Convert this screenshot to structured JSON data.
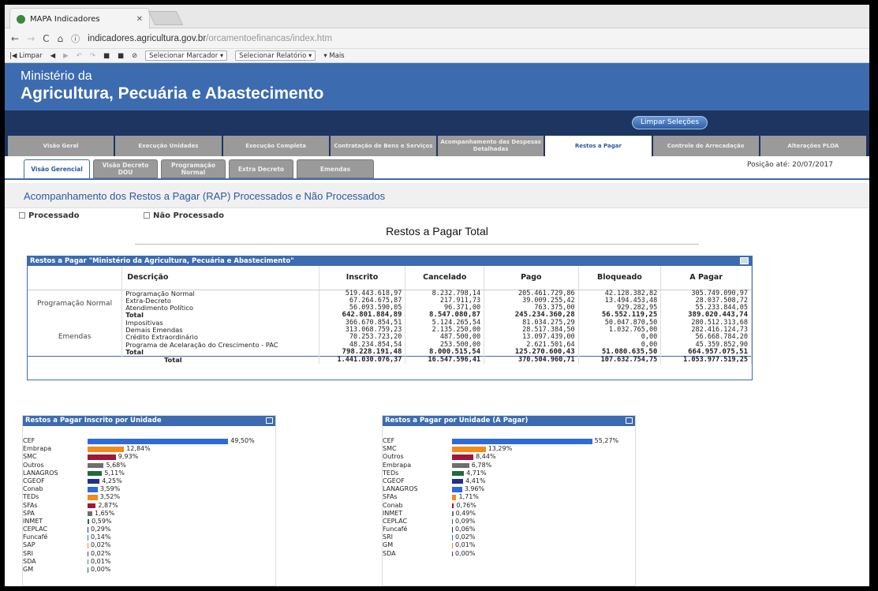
{
  "browser": {
    "tab_title": "MAPA Indicadores",
    "url_host": "indicadores.agricultura.gov.br",
    "url_path": "/orcamentoefinancas/index.htm",
    "bookmarks": {
      "clear": "Limpar",
      "marker": "Selecionar Marcador",
      "report": "Selecionar Relatório",
      "more": "Mais"
    }
  },
  "header": {
    "line1": "Ministério da",
    "line2": "Agricultura, Pecuária e Abastecimento",
    "clear_button": "Limpar Seleções"
  },
  "nav1": [
    {
      "label": "Visão Geral",
      "active": false
    },
    {
      "label": "Execução Unidades",
      "active": false
    },
    {
      "label": "Execução Completa",
      "active": false
    },
    {
      "label": "Contratação de Bens e Serviços",
      "active": false
    },
    {
      "label": "Acompanhamento das Despesas Detalhadas",
      "active": false
    },
    {
      "label": "Restos a Pagar",
      "active": true
    },
    {
      "label": "Controle de Arrecadação",
      "active": false
    },
    {
      "label": "Alterações PLOA",
      "active": false
    }
  ],
  "nav2": [
    {
      "label": "Visão Gerencial",
      "active": true
    },
    {
      "label": "Visão Decreto DOU",
      "active": false
    },
    {
      "label": "Programação Normal",
      "active": false
    },
    {
      "label": "Extra Decreto",
      "active": false
    },
    {
      "label": "Emendas",
      "active": false
    }
  ],
  "position_date": "Posição até: 20/07/2017",
  "section_title": "Acompanhamento dos Restos a Pagar (RAP) Processados e Não Processados",
  "filters": {
    "processed": "Processado",
    "not_processed": "Não Processado"
  },
  "report_title": "Restos a Pagar Total",
  "table": {
    "caption": "Restos a Pagar \"Ministério da Agricultura, Pecuária e Abastecimento\"",
    "columns": [
      "Descrição",
      "Inscrito",
      "Cancelado",
      "Pago",
      "Bloqueado",
      "A Pagar"
    ],
    "groups": [
      {
        "name": "Programação Normal",
        "rows": [
          [
            "Programação Normal",
            "519.443.618,97",
            "8.232.798,14",
            "205.461.729,86",
            "42.128.382,82",
            "305.749.090,97"
          ],
          [
            "Extra-Decreto",
            "67.264.675,87",
            "217.911,73",
            "39.009.255,42",
            "13.494.453,48",
            "28.037.508,72"
          ],
          [
            "Atendimento Político",
            "56.093.590,05",
            "96.371,00",
            "763.375,00",
            "929.282,95",
            "55.233.844,05"
          ],
          [
            "Total",
            "642.801.884,89",
            "8.547.080,87",
            "245.234.360,28",
            "56.552.119,25",
            "389.020.443,74"
          ]
        ]
      },
      {
        "name": "Emendas",
        "rows": [
          [
            "Impositivas",
            "366.670.854,51",
            "5.124.265,54",
            "81.034.275,29",
            "50.047.870,50",
            "280.512.313,68"
          ],
          [
            "Demais Emendas",
            "313.068.759,23",
            "2.135.250,00",
            "28.517.384,50",
            "1.032.765,00",
            "282.416.124,73"
          ],
          [
            "Crédito Extraordinário",
            "70.253.723,20",
            "487.500,00",
            "13.097.439,00",
            "0,00",
            "56.668.784,20"
          ],
          [
            "Programa de Acelaração do Crescimento - PAC",
            "48.234.854,54",
            "253.500,00",
            "2.621.501,64",
            "0,00",
            "45.359.852,90"
          ],
          [
            "Total",
            "798.228.191,48",
            "8.000.515,54",
            "125.270.600,43",
            "51.080.635,50",
            "664.957.075,51"
          ]
        ]
      }
    ],
    "total": [
      "Total",
      "1.441.030.076,37",
      "16.547.596,41",
      "370.504.960,71",
      "107.632.754,75",
      "1.053.977.519,25"
    ]
  },
  "chart_data": [
    {
      "type": "bar",
      "title": "Restos a Pagar Inscrito por Unidade",
      "categories": [
        "CEF",
        "Embrapa",
        "SMC",
        "Outros",
        "LANAGROS",
        "CGEOF",
        "Conab",
        "TEDs",
        "SFAs",
        "SPA",
        "INMET",
        "CEPLAC",
        "Funcafé",
        "SAP",
        "SRI",
        "SDA",
        "GM"
      ],
      "values": [
        49.5,
        12.84,
        9.93,
        5.68,
        5.11,
        4.25,
        3.59,
        3.52,
        2.87,
        1.65,
        0.59,
        0.29,
        0.14,
        0.02,
        0.02,
        0.01,
        0.0
      ],
      "labels": [
        "49,50%",
        "12,84%",
        "9,93%",
        "5,68%",
        "5,11%",
        "4,25%",
        "3,59%",
        "3,52%",
        "2,87%",
        "1,65%",
        "0,59%",
        "0,29%",
        "0,14%",
        "0,02%",
        "0,02%",
        "0,01%",
        "0,00%"
      ],
      "colors": [
        "#2f6bd8",
        "#f28a1c",
        "#a0173a",
        "#6e6e6e",
        "#1f6a3e",
        "#1f2f8a",
        "#2f6bd8",
        "#f28a1c",
        "#a0173a",
        "#6e6e6e",
        "#1f6a3e",
        "#1f2f8a",
        "#2f6bd8",
        "#f28a1c",
        "#a0173a",
        "#6e6e6e",
        "#1f6a3e"
      ],
      "xlim": [
        0,
        50
      ]
    },
    {
      "type": "bar",
      "title": "Restos a Pagar por Unidade (A Pagar)",
      "categories": [
        "CEF",
        "SMC",
        "Outros",
        "Embrapa",
        "TEDs",
        "CGEOF",
        "LANAGROS",
        "SFAs",
        "Conab",
        "INMET",
        "CEPLAC",
        "Funcafé",
        "SRI",
        "GM",
        "SDA"
      ],
      "values": [
        55.27,
        13.29,
        8.44,
        6.78,
        4.71,
        4.41,
        3.96,
        1.71,
        0.76,
        0.49,
        0.09,
        0.06,
        0.02,
        0.01,
        0.0
      ],
      "labels": [
        "55,27%",
        "13,29%",
        "8,44%",
        "6,78%",
        "4,71%",
        "4,41%",
        "3,96%",
        "1,71%",
        "0,76%",
        "0,49%",
        "0,09%",
        "0,06%",
        "0,02%",
        "0,01%",
        "0,00%"
      ],
      "colors": [
        "#2f6bd8",
        "#f28a1c",
        "#a0173a",
        "#6e6e6e",
        "#1f6a3e",
        "#1f2f8a",
        "#2f6bd8",
        "#f28a1c",
        "#a0173a",
        "#6e6e6e",
        "#1f6a3e",
        "#1f2f8a",
        "#2f6bd8",
        "#f28a1c",
        "#a0173a"
      ],
      "xlim": [
        0,
        56
      ]
    }
  ]
}
